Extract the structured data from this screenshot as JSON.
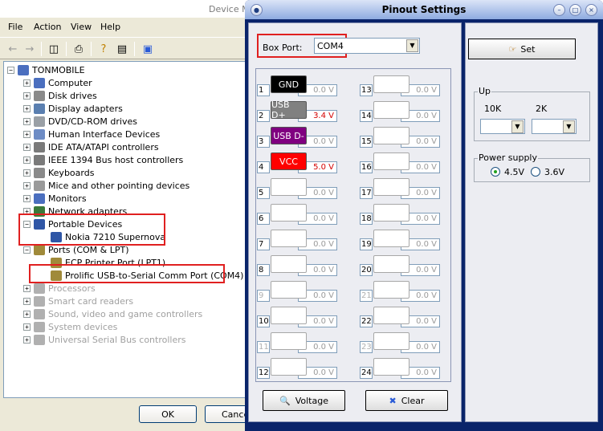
{
  "device_manager": {
    "title": "Device M",
    "menu": [
      "File",
      "Action",
      "View",
      "Help"
    ],
    "tree": {
      "root": "TONMOBILE",
      "items": [
        {
          "label": "Computer",
          "icon": "computer-icon"
        },
        {
          "label": "Disk drives",
          "icon": "disk-drive-icon"
        },
        {
          "label": "Display adapters",
          "icon": "display-adapter-icon"
        },
        {
          "label": "DVD/CD-ROM drives",
          "icon": "dvd-drive-icon"
        },
        {
          "label": "Human Interface Devices",
          "icon": "hid-icon"
        },
        {
          "label": "IDE ATA/ATAPI controllers",
          "icon": "ide-controller-icon"
        },
        {
          "label": "IEEE 1394 Bus host controllers",
          "icon": "ieee1394-icon"
        },
        {
          "label": "Keyboards",
          "icon": "keyboard-icon"
        },
        {
          "label": "Mice and other pointing devices",
          "icon": "mouse-icon"
        },
        {
          "label": "Monitors",
          "icon": "monitor-icon"
        },
        {
          "label": "Network adapters",
          "icon": "network-adapter-icon"
        },
        {
          "label": "Portable Devices",
          "icon": "portable-device-icon"
        },
        {
          "label": "Nokia 7210 Supernova",
          "icon": "phone-icon"
        },
        {
          "label": "Ports (COM & LPT)",
          "icon": "port-icon"
        },
        {
          "label": "ECP Printer Port (LPT1)",
          "icon": "printer-port-icon"
        },
        {
          "label": "Prolific USB-to-Serial Comm Port (COM4)",
          "icon": "serial-port-icon"
        },
        {
          "label": "Processors",
          "icon": "processor-icon"
        },
        {
          "label": "Smart card readers",
          "icon": "smart-card-icon"
        },
        {
          "label": "Sound, video and game controllers",
          "icon": "sound-icon"
        },
        {
          "label": "System devices",
          "icon": "system-device-icon"
        },
        {
          "label": "Universal Serial Bus controllers",
          "icon": "usb-icon"
        }
      ]
    },
    "ok_label": "OK",
    "cancel_label": "Cance"
  },
  "pinout": {
    "title": "Pinout Settings",
    "box_port_label": "Box Port:",
    "box_port_value": "COM4",
    "set_label": "Set",
    "pins": [
      {
        "num": "1",
        "name": "GND",
        "voltage": "0.0 V"
      },
      {
        "num": "2",
        "name": "USB D+",
        "voltage": "3.4 V"
      },
      {
        "num": "3",
        "name": "USB D-",
        "voltage": "0.0 V"
      },
      {
        "num": "4",
        "name": "VCC",
        "voltage": "5.0 V"
      },
      {
        "num": "5",
        "name": "",
        "voltage": "0.0 V"
      },
      {
        "num": "6",
        "name": "",
        "voltage": "0.0 V"
      },
      {
        "num": "7",
        "name": "",
        "voltage": "0.0 V"
      },
      {
        "num": "8",
        "name": "",
        "voltage": "0.0 V"
      },
      {
        "num": "9",
        "name": "",
        "voltage": "0.0 V"
      },
      {
        "num": "10",
        "name": "",
        "voltage": "0.0 V"
      },
      {
        "num": "11",
        "name": "",
        "voltage": "0.0 V"
      },
      {
        "num": "12",
        "name": "",
        "voltage": "0.0 V"
      },
      {
        "num": "13",
        "name": "",
        "voltage": "0.0 V"
      },
      {
        "num": "14",
        "name": "",
        "voltage": "0.0 V"
      },
      {
        "num": "15",
        "name": "",
        "voltage": "0.0 V"
      },
      {
        "num": "16",
        "name": "",
        "voltage": "0.0 V"
      },
      {
        "num": "17",
        "name": "",
        "voltage": "0.0 V"
      },
      {
        "num": "18",
        "name": "",
        "voltage": "0.0 V"
      },
      {
        "num": "19",
        "name": "",
        "voltage": "0.0 V"
      },
      {
        "num": "20",
        "name": "",
        "voltage": "0.0 V"
      },
      {
        "num": "21",
        "name": "",
        "voltage": "0.0 V"
      },
      {
        "num": "22",
        "name": "",
        "voltage": "0.0 V"
      },
      {
        "num": "23",
        "name": "",
        "voltage": "0.0 V"
      },
      {
        "num": "24",
        "name": "",
        "voltage": "0.0 V"
      }
    ],
    "voltage_label": "Voltage",
    "clear_label": "Clear",
    "up_legend": "Up",
    "up_10k_label": "10K",
    "up_2k_label": "2K",
    "power_supply_legend": "Power supply",
    "power_options": [
      "4.5V",
      "3.6V"
    ]
  },
  "colors": {
    "gnd": "#000000",
    "usb_dplus": "#808080",
    "usb_dminus": "#800080",
    "vcc": "#ff0000",
    "voltage_red": "#d40000",
    "highlight_red": "#e02020"
  }
}
